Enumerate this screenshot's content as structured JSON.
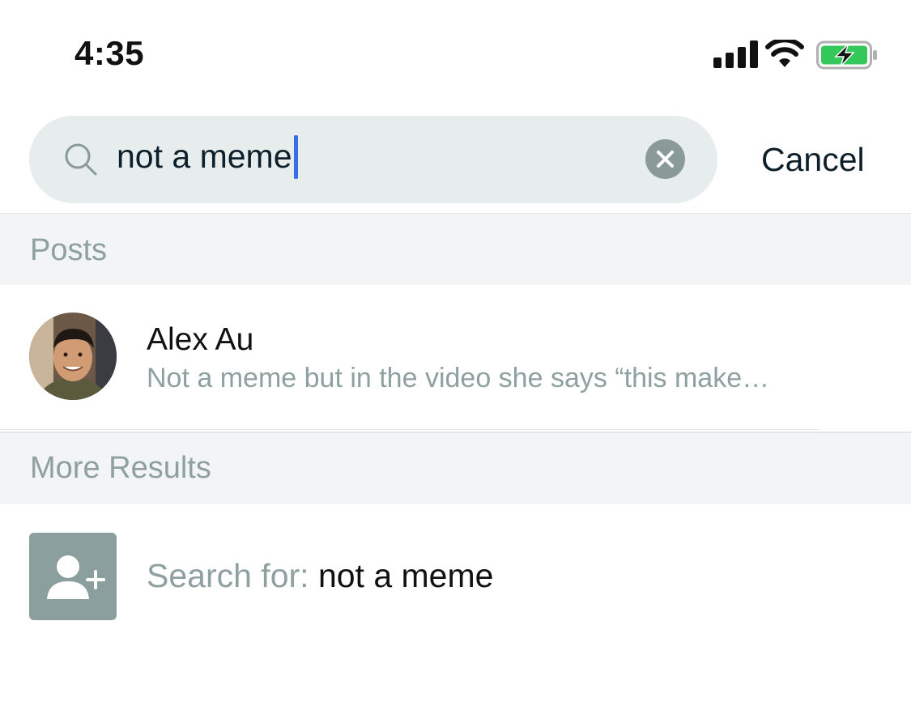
{
  "status_bar": {
    "time": "4:35",
    "signal_icon": "signal-bars-icon",
    "wifi_icon": "wifi-icon",
    "battery_icon": "battery-charging-icon",
    "battery_color": "#34c759"
  },
  "search": {
    "query": "not a meme",
    "search_icon": "magnifier-icon",
    "clear_icon": "clear-icon",
    "cancel_label": "Cancel",
    "caret_color": "#3a6de8"
  },
  "sections": {
    "posts_title": "Posts",
    "more_results_title": "More Results"
  },
  "posts": [
    {
      "author": "Alex Au",
      "snippet": "Not a meme but in the video she says “this make…",
      "avatar": "avatar-photo"
    }
  ],
  "more_results": {
    "search_for_label": "Search for:",
    "query": "not a meme",
    "icon": "add-person-icon"
  }
}
